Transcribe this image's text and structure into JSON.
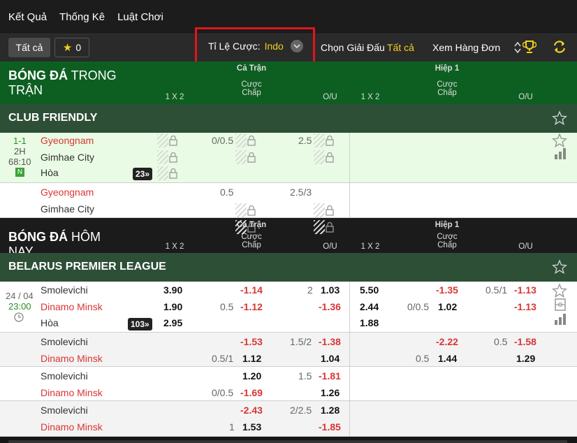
{
  "topnav": {
    "items": [
      "Kết Quả",
      "Thống Kê",
      "Luật Chơi"
    ]
  },
  "toolbar": {
    "all_label": "Tất cả",
    "star_count": "0",
    "odds_label": "Tỉ Lệ Cược:",
    "odds_value": "Indo",
    "choose_league": "Chọn Giải Đấu",
    "choose_league_value": "Tất cả",
    "view_single": "Xem Hàng Đơn"
  },
  "section_live": {
    "title_bold": "BÓNG ĐÁ",
    "title_rest": " TRONG TRẬN"
  },
  "section_today": {
    "title_bold": "BÓNG ĐÁ",
    "title_rest": " HÔM NAY"
  },
  "columns": {
    "full": "Cả Trận",
    "half": "Hiệp 1",
    "one_x_two": "1 X 2",
    "handicap_line1": "Cược",
    "handicap_line2": "Chấp",
    "ou": "O/U"
  },
  "league_friendly": "CLUB FRIENDLY",
  "league_belarus": "BELARUS PREMIER LEAGUE",
  "live_match": {
    "score": "1-1",
    "period": "2H",
    "time": "68:10",
    "neutral": "N",
    "home": "Gyeongnam",
    "away": "Gimhae City",
    "draw": "Hòa",
    "more": "23",
    "hdp": "0/0.5",
    "ou": "2.5",
    "hdp2": "0.5",
    "ou2": "2.5/3"
  },
  "today_match": {
    "date": "24 / 04",
    "time": "23:00",
    "home": "Smolevichi",
    "away": "Dinamo Minsk",
    "draw": "Hòa",
    "more": "103",
    "main": {
      "x12_h": "3.90",
      "x12_a": "1.90",
      "x12_d": "2.95",
      "hdp_a_line": "0.5",
      "hdp_h": "-1.14",
      "hdp_a": "-1.12",
      "ou_line": "2",
      "ou_o": "1.03",
      "ou_u": "-1.36",
      "h1_x12_h": "5.50",
      "h1_x12_a": "2.44",
      "h1_x12_d": "1.88",
      "h1_hdp_a_line": "0/0.5",
      "h1_hdp_h": "-1.35",
      "h1_hdp_a": "1.02",
      "h1_ou_line": "0.5/1",
      "h1_ou_o": "-1.13",
      "h1_ou_u": "-1.13"
    },
    "alt1": {
      "hdp_a_line": "0.5/1",
      "hdp_h": "-1.53",
      "hdp_a": "1.12",
      "ou_line": "1.5/2",
      "ou_o": "-1.38",
      "ou_u": "1.04",
      "h1_hdp_a_line": "0.5",
      "h1_hdp_h": "-2.22",
      "h1_hdp_a": "1.44",
      "h1_ou_line": "0.5",
      "h1_ou_o": "-1.58",
      "h1_ou_u": "1.29"
    },
    "alt2": {
      "hdp_a_line": "0/0.5",
      "hdp_h": "1.20",
      "hdp_a": "-1.69",
      "ou_line": "1.5",
      "ou_o": "-1.81",
      "ou_u": "1.26"
    },
    "alt3": {
      "hdp_line": "1",
      "hdp_h": "-2.43",
      "hdp_a": "1.53",
      "ou_line": "2/2.5",
      "ou_o": "1.28",
      "ou_u": "-1.85"
    }
  }
}
